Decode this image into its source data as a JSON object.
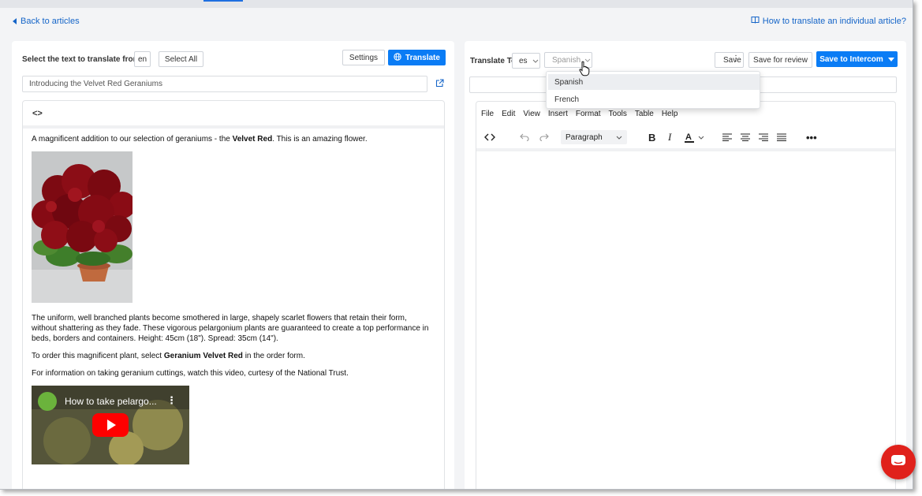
{
  "nav": {
    "back_label": "Back to articles",
    "help_label": "How to translate an individual article?"
  },
  "source": {
    "select_label": "Select the text to translate from",
    "lang_code": "en",
    "select_all_label": "Select All",
    "settings_label": "Settings",
    "translate_label": "Translate",
    "title_value": "Introducing the Velvet Red Geraniums",
    "source_toggle": "<>",
    "article": {
      "p1_before": "A magnificent addition to our selection of geraniums - the ",
      "p1_bold": "Velvet Red",
      "p1_after": ". This is an amazing flower.",
      "p2": "The uniform, well branched plants become smothered in large, shapely scarlet flowers that retain their form, without shattering as they fade. These vigorous pelargonium plants are guaranteed to create a top performance in beds, borders and containers. Height: 45cm (18\"). Spread: 35cm (14\").",
      "p3_before": "To order this magnificent plant, select ",
      "p3_bold": "Geranium Velvet Red",
      "p3_after": " in the order form.",
      "p4": "For information on taking geranium cuttings, watch this video, curtesy of the National Trust.",
      "video_title": "How to take pelargo..."
    }
  },
  "target": {
    "translate_to_label": "Translate To",
    "lang_code": "es",
    "lang_select_value": "Spanish",
    "save_label": "Save",
    "save_review_label": "Save for review",
    "save_intercom_label": "Save to Intercom",
    "menu": [
      "File",
      "Edit",
      "View",
      "Insert",
      "Format",
      "Tools",
      "Table",
      "Help"
    ],
    "block_format": "Paragraph",
    "language_options": [
      "Spanish",
      "French"
    ]
  },
  "colors": {
    "accent": "#0a7cf5",
    "link": "#1565c8",
    "chat": "#e0211b"
  }
}
